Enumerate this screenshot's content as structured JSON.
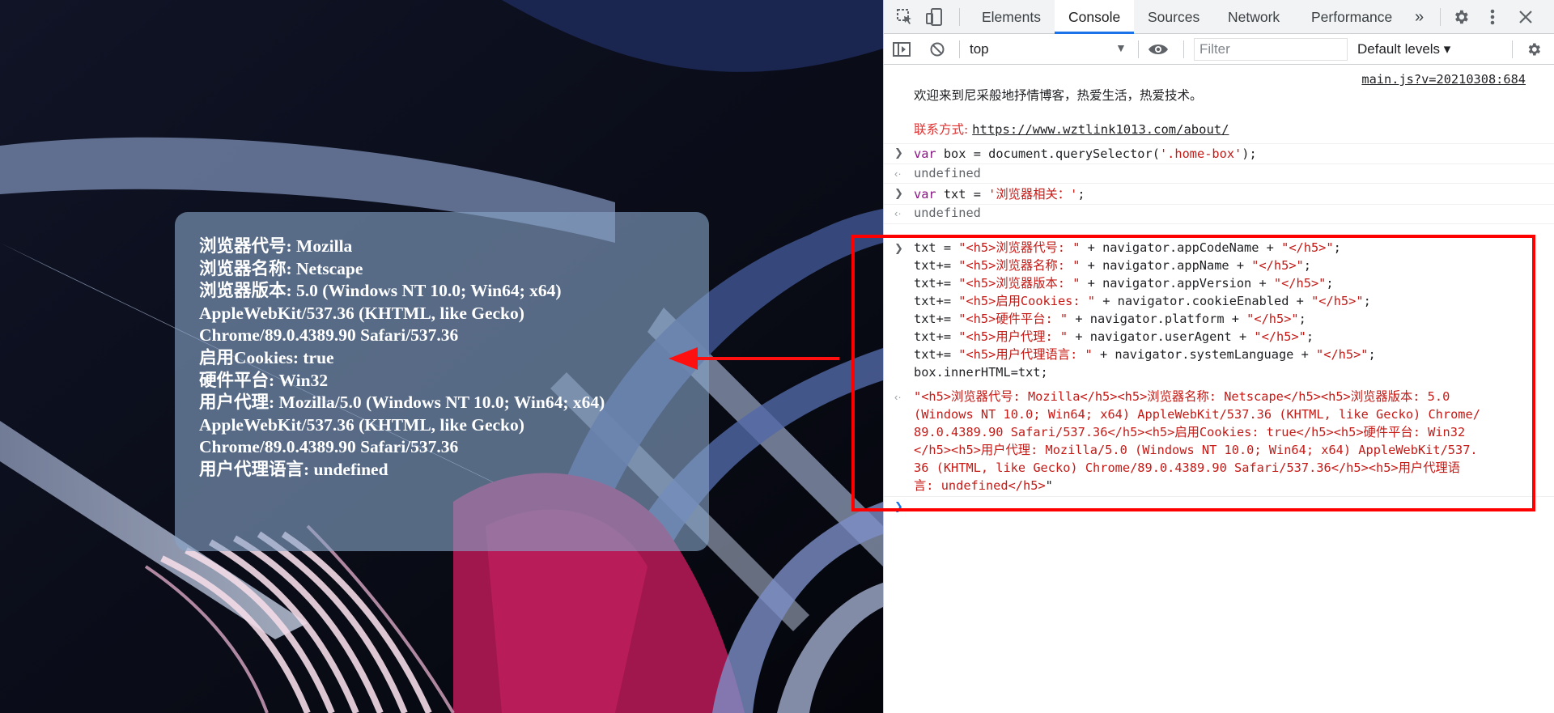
{
  "page": {
    "browser_info_lines": [
      "浏览器代号: Mozilla",
      "浏览器名称: Netscape",
      "浏览器版本: 5.0 (Windows NT 10.0; Win64; x64)",
      "AppleWebKit/537.36 (KHTML, like Gecko)",
      "Chrome/89.0.4389.90 Safari/537.36",
      "启用Cookies: true",
      "硬件平台: Win32",
      "用户代理: Mozilla/5.0 (Windows NT 10.0; Win64; x64)",
      "AppleWebKit/537.36 (KHTML, like Gecko)",
      "Chrome/89.0.4389.90 Safari/537.36",
      "用户代理语言: undefined"
    ]
  },
  "devtools": {
    "tabs": [
      "Elements",
      "Console",
      "Sources",
      "Network",
      "Performance"
    ],
    "active_tab": "Console",
    "more_tabs_icon": "»",
    "context": "top",
    "filter_placeholder": "Filter",
    "levels_label": "Default levels ▾",
    "console": {
      "source_link": "main.js?v=20210308:684",
      "welcome": "欢迎来到尼采般地抒情博客，热爱生活，热爱技术。",
      "contact_label": "联系方式: ",
      "contact_url": "https://www.wztlink1013.com/about/",
      "cmd1": {
        "kw": "var",
        "rest": " box = document.querySelector(",
        "str": "'.home-box'",
        "end": ");"
      },
      "result1": "undefined",
      "cmd2": {
        "kw": "var",
        "rest": " txt = ",
        "str": "'浏览器相关：'",
        "end": ";"
      },
      "result2": "undefined",
      "cmd3_lines": [
        {
          "a": "txt = ",
          "s1": "\"<h5>浏览器代号: \"",
          "b": " + navigator.appCodeName + ",
          "s2": "\"</h5>\"",
          "c": ";"
        },
        {
          "a": "txt+= ",
          "s1": "\"<h5>浏览器名称: \"",
          "b": " + navigator.appName + ",
          "s2": "\"</h5>\"",
          "c": ";"
        },
        {
          "a": "txt+= ",
          "s1": "\"<h5>浏览器版本: \"",
          "b": " + navigator.appVersion + ",
          "s2": "\"</h5>\"",
          "c": ";"
        },
        {
          "a": "txt+= ",
          "s1": "\"<h5>启用Cookies: \"",
          "b": " + navigator.cookieEnabled + ",
          "s2": "\"</h5>\"",
          "c": ";"
        },
        {
          "a": "txt+= ",
          "s1": "\"<h5>硬件平台: \"",
          "b": " + navigator.platform + ",
          "s2": "\"</h5>\"",
          "c": ";"
        },
        {
          "a": "txt+= ",
          "s1": "\"<h5>用户代理: \"",
          "b": " + navigator.userAgent + ",
          "s2": "\"</h5>\"",
          "c": ";"
        },
        {
          "a": "txt+= ",
          "s1": "\"<h5>用户代理语言: \"",
          "b": " + navigator.systemLanguage + ",
          "s2": "\"</h5>\"",
          "c": ";"
        },
        {
          "a": "box.innerHTML=txt;",
          "s1": "",
          "b": "",
          "s2": "",
          "c": ""
        }
      ],
      "result3_lines": [
        "\"<h5>浏览器代号: Mozilla</h5><h5>浏览器名称: Netscape</h5><h5>浏览器版本: 5.0",
        "(Windows NT 10.0; Win64; x64) AppleWebKit/537.36 (KHTML, like Gecko) Chrome/",
        "89.0.4389.90 Safari/537.36</h5><h5>启用Cookies: true</h5><h5>硬件平台: Win32",
        "</h5><h5>用户代理: Mozilla/5.0 (Windows NT 10.0; Win64; x64) AppleWebKit/537.",
        "36 (KHTML, like Gecko) Chrome/89.0.4389.90 Safari/537.36</h5><h5>用户代理语",
        "言: undefined</h5>"
      ],
      "result3_close_quote": "\""
    }
  },
  "colors": {
    "accent_blue": "#1a73e8",
    "highlight_red": "#ff0000",
    "string_red": "#c41a16",
    "keyword_purple": "#881280"
  }
}
